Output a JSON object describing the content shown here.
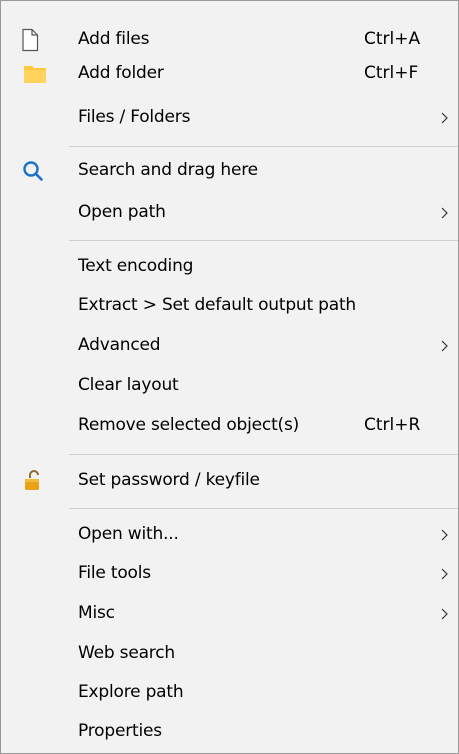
{
  "menu": {
    "items": [
      {
        "label": "Add files",
        "shortcut": "Ctrl+A",
        "icon": "file-icon"
      },
      {
        "label": "Add folder",
        "shortcut": "Ctrl+F",
        "icon": "folder-icon"
      },
      {
        "label": "Files / Folders",
        "submenu": true
      },
      {
        "label": "Search and drag here",
        "icon": "search-icon"
      },
      {
        "label": "Open path",
        "submenu": true
      },
      {
        "label": "Text encoding"
      },
      {
        "label": "Extract > Set default output path"
      },
      {
        "label": "Advanced",
        "submenu": true
      },
      {
        "label": "Clear layout"
      },
      {
        "label": "Remove selected object(s)",
        "shortcut": "Ctrl+R"
      },
      {
        "label": "Set password / keyfile",
        "icon": "lock-icon"
      },
      {
        "label": "Open with...",
        "submenu": true
      },
      {
        "label": "File tools",
        "submenu": true
      },
      {
        "label": "Misc",
        "submenu": true
      },
      {
        "label": "Web search"
      },
      {
        "label": "Explore path"
      },
      {
        "label": "Properties"
      }
    ]
  },
  "colors": {
    "menu_background": "#f2f2f2",
    "border": "#999999",
    "separator": "#cfcfcf",
    "folder_yellow": "#ffc83d",
    "search_blue": "#1a73c9",
    "lock_gold": "#e8a317"
  }
}
